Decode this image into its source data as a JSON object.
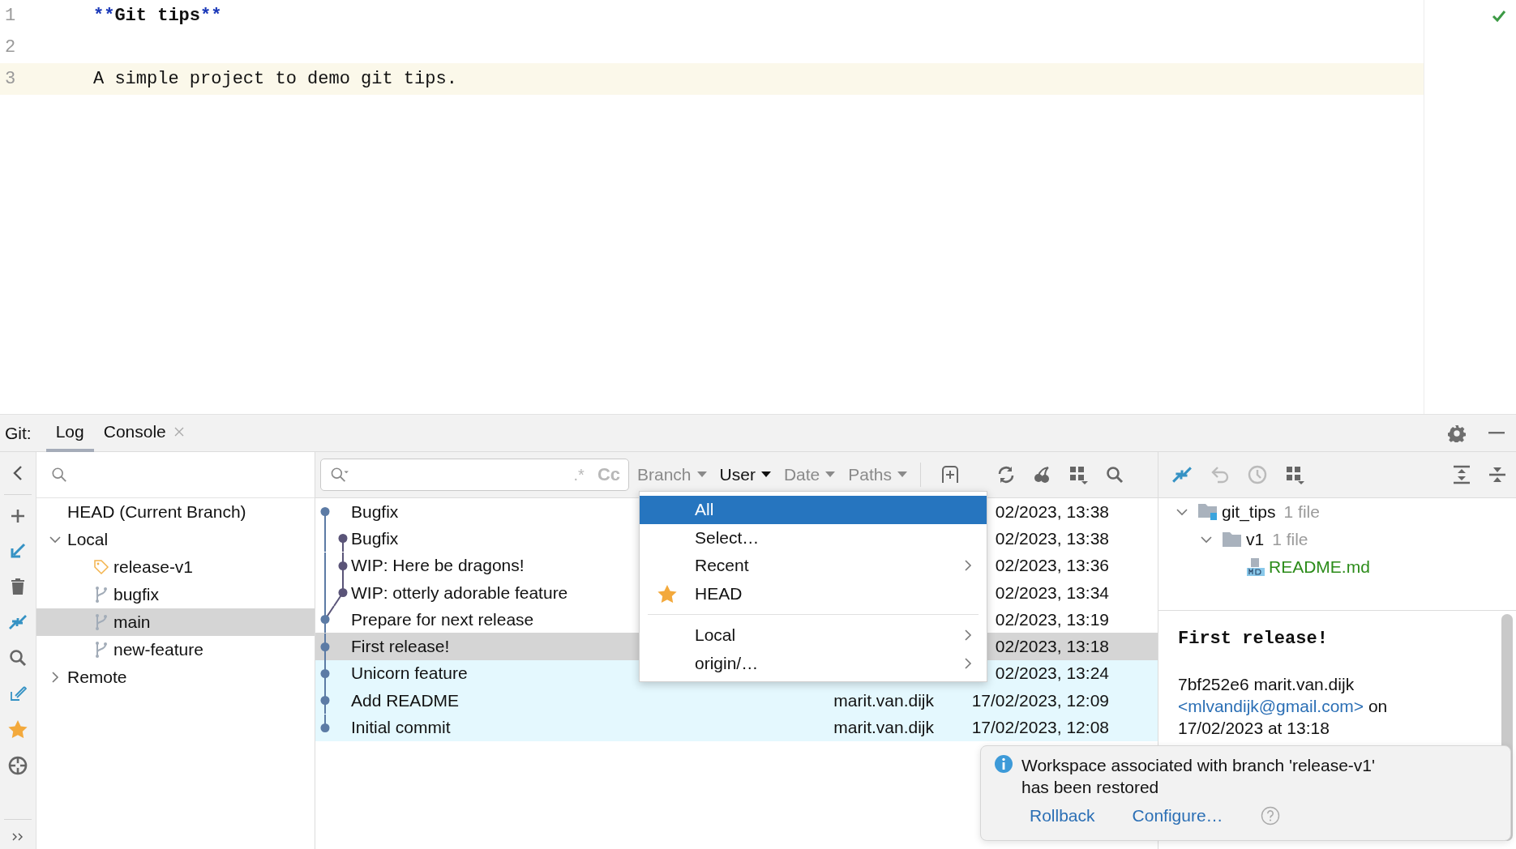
{
  "editor": {
    "lines": [
      {
        "number": "1",
        "current": false,
        "tokens": [
          {
            "text": "**",
            "kind": "markup"
          },
          {
            "text": "Git tips",
            "kind": "strong"
          },
          {
            "text": "**",
            "kind": "markup"
          }
        ]
      },
      {
        "number": "2",
        "current": false
      },
      {
        "number": "3",
        "current": true,
        "tokens": [
          {
            "text": "A simple project to demo git tips.",
            "kind": "plain"
          }
        ]
      }
    ]
  },
  "tool_window": {
    "title": "Git:",
    "tabs": [
      {
        "label": "Log",
        "selected": true,
        "closable": false
      },
      {
        "label": "Console",
        "selected": false,
        "closable": true
      }
    ]
  },
  "branches": {
    "tree": [
      {
        "label": "HEAD (Current Branch)",
        "kind": "head",
        "selected": false
      },
      {
        "label": "Local",
        "kind": "group",
        "expanded": true,
        "selected": false,
        "children": [
          {
            "label": "release-v1",
            "kind": "tag",
            "selected": false
          },
          {
            "label": "bugfix",
            "kind": "branch",
            "selected": false
          },
          {
            "label": "main",
            "kind": "branch",
            "selected": true
          },
          {
            "label": "new-feature",
            "kind": "branch",
            "selected": false
          }
        ]
      },
      {
        "label": "Remote",
        "kind": "group",
        "expanded": false,
        "selected": false
      }
    ]
  },
  "log": {
    "search": {
      "regex_toggle": ".*",
      "case_toggle": "Cc"
    },
    "filters": [
      {
        "label": "Branch",
        "active": false
      },
      {
        "label": "User",
        "active": true
      },
      {
        "label": "Date",
        "active": false
      },
      {
        "label": "Paths",
        "active": false
      }
    ],
    "commits": [
      {
        "message": "Bugfix",
        "kind": "main",
        "date": "02/2023, 13:38",
        "selected": false,
        "highlighted": false
      },
      {
        "message": "Bugfix",
        "kind": "branch",
        "date": "02/2023, 13:38",
        "selected": false,
        "highlighted": false
      },
      {
        "message": "WIP: Here be dragons!",
        "kind": "branch",
        "date": "02/2023, 13:36",
        "selected": false,
        "highlighted": false
      },
      {
        "message": "WIP: otterly adorable feature",
        "kind": "branch",
        "date": "02/2023, 13:34",
        "selected": false,
        "highlighted": false
      },
      {
        "message": "Prepare for next release",
        "kind": "main",
        "date": "02/2023, 13:19",
        "selected": false,
        "highlighted": false
      },
      {
        "message": "First release!",
        "kind": "main",
        "date": "02/2023, 13:18",
        "selected": true,
        "highlighted": false
      },
      {
        "message": "Unicorn feature",
        "kind": "main",
        "date": "02/2023, 13:24",
        "selected": false,
        "highlighted": true
      },
      {
        "message": "Add README",
        "kind": "main",
        "author": "marit.van.dijk",
        "date": "17/02/2023, 12:09",
        "selected": false,
        "highlighted": true
      },
      {
        "message": "Initial commit",
        "kind": "main",
        "author": "marit.van.dijk",
        "date": "17/02/2023, 12:08",
        "selected": false,
        "highlighted": true
      }
    ],
    "user_menu": {
      "groups": [
        [
          {
            "label": "All",
            "selected": true,
            "submenu": false,
            "starred": false
          },
          {
            "label": "Select…",
            "selected": false,
            "submenu": false,
            "starred": false
          },
          {
            "label": "Recent",
            "selected": false,
            "submenu": true,
            "starred": false
          },
          {
            "label": "HEAD",
            "selected": false,
            "submenu": false,
            "starred": true
          }
        ],
        [
          {
            "label": "Local",
            "selected": false,
            "submenu": true,
            "starred": false
          },
          {
            "label": "origin/…",
            "selected": false,
            "submenu": true,
            "starred": false
          }
        ]
      ]
    }
  },
  "changes": {
    "tree": [
      {
        "label": "git_tips",
        "count": "1 file",
        "kind": "module",
        "expanded": true,
        "children": [
          {
            "label": "v1",
            "count": "1 file",
            "kind": "folder",
            "expanded": true,
            "children": [
              {
                "label": "README.md",
                "kind": "markdown"
              }
            ]
          }
        ]
      }
    ],
    "details": {
      "subject": "First release!",
      "hash": "7bf252e6",
      "author": "marit.van.dijk",
      "email": "<mlvandijk@gmail.com>",
      "on": "on",
      "date": "17/02/2023 at 13:18"
    }
  },
  "notification": {
    "kind": "info",
    "lines": [
      "Workspace associated with branch 'release-v1'",
      "has been restored"
    ],
    "actions": [
      "Rollback",
      "Configure…"
    ]
  }
}
